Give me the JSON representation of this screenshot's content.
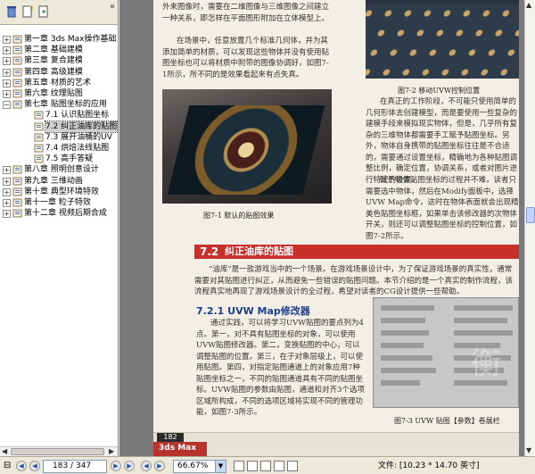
{
  "tree": {
    "items": [
      {
        "label": "第一章 3ds Max操作基础",
        "expanded": false
      },
      {
        "label": "第二章 基础建模",
        "expanded": false
      },
      {
        "label": "第三章 复合建模",
        "expanded": false
      },
      {
        "label": "第四章 高级建模",
        "expanded": false
      },
      {
        "label": "第五章 材质的艺术",
        "expanded": false
      },
      {
        "label": "第六章 纹理贴图",
        "expanded": false
      },
      {
        "label": "第七章 贴图坐标的应用",
        "expanded": true
      },
      {
        "label": "7.1 认识贴图坐标",
        "child": true
      },
      {
        "label": "7.2 纠正油库的贴图",
        "child": true,
        "selected": true
      },
      {
        "label": "7.3 展开油桶的UV",
        "child": true
      },
      {
        "label": "7.4 烘焙法线贴图",
        "child": true
      },
      {
        "label": "7.5 高手答疑",
        "child": true
      },
      {
        "label": "第八章 照明创意设计",
        "expanded": false
      },
      {
        "label": "第九章 三维动画",
        "expanded": false
      },
      {
        "label": "第十章 典型环境特效",
        "expanded": false
      },
      {
        "label": "第十一章 粒子特效",
        "expanded": false
      },
      {
        "label": "第十二章 视频后期合成",
        "expanded": false
      }
    ]
  },
  "page": {
    "top_left_text": "外来图像时，需要在二维图像与三维图像之间建立一种关系，即怎样在平面图形附加在立体模型上。",
    "scene_text": "在场景中，任意放置几个标准几何体，并为其添加简单的材质，可以发现这些物体并没有使用贴图坐标也可以将材质中附带的图像协调好，如图7-1所示，所不同的是效果看起来有点失真。",
    "fig1_caption": "图7-1   默认的贴图效果",
    "fig2_caption": "图7-2   移动UVW控制位置",
    "right_text_1": "在真正的工作阶段，不可能只使用简单的几何形体去创建模型，而是要使用一些复杂的建模手段来模拟现实物体，但是，几乎所有复杂的三维物体都需要手工赋予贴图坐标。另外，物体自身携带的贴图坐标往往是不合适的，需要通过设置坐标，精确地为各种贴图调整比例，确定位置，协调关系，或者对图片进行特定的设置。",
    "right_text_2": "赋予物体贴图坐标的过程并不难，读者只需要选中物体，然后在Modify面板中，选择UVW Map命令，这时在物体表面就会出现精美色贴图坐标框，如果单击该修改器的次物体开关，则还可以调整贴图坐标的控制位置，如图7-2所示。",
    "section_num": "7.2",
    "section_title": "纠正油库的贴图",
    "intro_text": "“油库”是一款游戏当中的一个场景。在游戏场景设计中，为了保证游戏场景的真实性，通常需要对其贴图进行纠正，从而避免一些错误的贴图问题。本节介绍的是一个真实的制作流程，该流程真实地再现了游戏场景设计的全过程，希望对读者的CG设计提供一些帮助。",
    "subsection": "7.2.1   UVW Map修改器",
    "sub_text": "通过实践，可以将学习UVW贴图的要点列为4点。第一，对不具有贴图坐标的对象，可以使用UVW贴图修改器。第二，变换贴图的中心，可以调整贴图的位置。第三，在子对象层级上，可以使用贴图。第四，对指定贴图通道上的对象应用7种贴图坐标之一，不同的贴图通道具有不同的贴图坐标。UVW贴图的参数由贴图，通道和对齐3个选项区域所构成，不同的选项区域将实现不同的管理功能，如图7-3所示。",
    "fig3_caption": "图7-3   UVW 贴图【参数】卷展栏",
    "footer_page": "182",
    "footer_brand": "3ds Max"
  },
  "status": {
    "current_page": "183",
    "total_pages": "347",
    "page_label": "183 / 347",
    "zoom": "66.67%",
    "doc_size": "文件: [10.23 * 14.70 英寸]"
  }
}
